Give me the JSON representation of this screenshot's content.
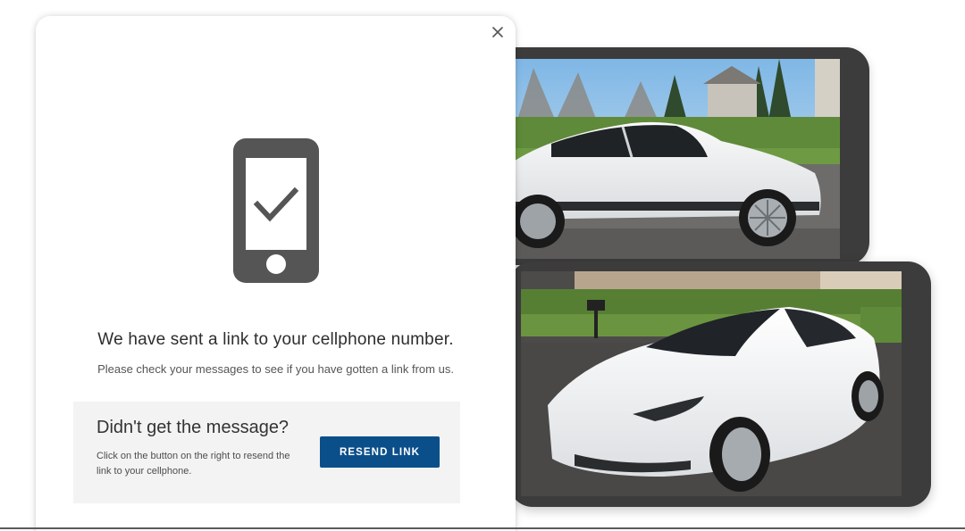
{
  "modal": {
    "close_icon": "close-icon",
    "illustration_icon": "phone-check-icon",
    "headline": "We have sent a link to your cellphone number.",
    "subline": "Please check your messages to see if you have gotten a link from us."
  },
  "resend": {
    "title": "Didn't get the message?",
    "description": "Click on the button on the right to resend the link to your cellphone.",
    "button_label": "RESEND LINK"
  },
  "colors": {
    "accent": "#0b4f8a",
    "device_frame": "#3c3c3c",
    "panel_bg": "#f3f3f3",
    "icon_gray": "#555555"
  }
}
